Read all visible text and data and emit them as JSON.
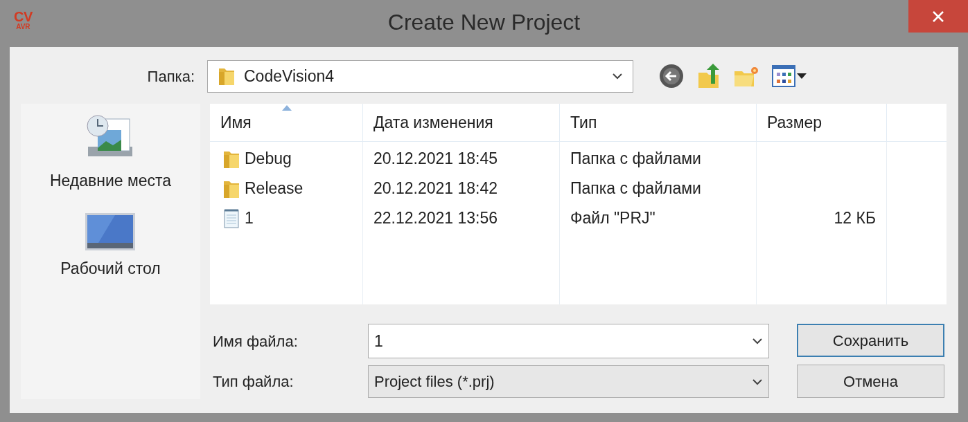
{
  "window": {
    "title": "Create New Project",
    "logo": {
      "line1": "CV",
      "line2": "AVR"
    }
  },
  "folder": {
    "label": "Папка:",
    "value": "CodeVision4"
  },
  "places": [
    {
      "label": "Недавние места",
      "kind": "recent"
    },
    {
      "label": "Рабочий стол",
      "kind": "desktop"
    }
  ],
  "table": {
    "columns": [
      {
        "label": "Имя",
        "sorted": true
      },
      {
        "label": "Дата изменения",
        "sorted": false
      },
      {
        "label": "Тип",
        "sorted": false
      },
      {
        "label": "Размер",
        "sorted": false
      }
    ],
    "rows": [
      {
        "kind": "folder",
        "name": "Debug",
        "date": "20.12.2021 18:45",
        "type": "Папка с файлами"
      },
      {
        "kind": "folder",
        "name": "Release",
        "date": "20.12.2021 18:42",
        "type": "Папка с файлами"
      },
      {
        "kind": "file",
        "name": "1",
        "date": "22.12.2021 13:56",
        "type": "Файл \"PRJ\"",
        "size": "12 КБ"
      }
    ]
  },
  "filename": {
    "label": "Имя файла:",
    "value": "1"
  },
  "filetype": {
    "label": "Тип файла:",
    "value": "Project files (*.prj)"
  },
  "buttons": [
    {
      "label": "Сохранить",
      "default": true
    },
    {
      "label": "Отмена",
      "default": false
    }
  ]
}
